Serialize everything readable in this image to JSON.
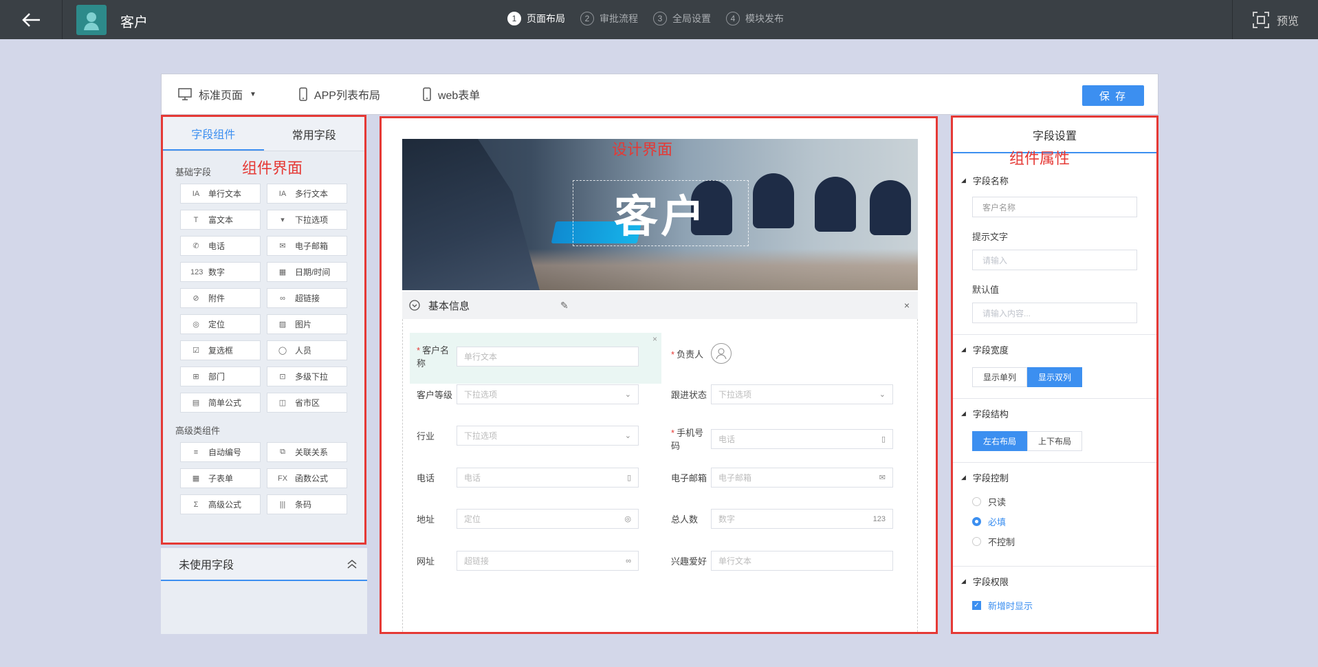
{
  "topbar": {
    "title": "客户",
    "steps": [
      {
        "num": "1",
        "label": "页面布局",
        "active": true
      },
      {
        "num": "2",
        "label": "审批流程",
        "active": false
      },
      {
        "num": "3",
        "label": "全局设置",
        "active": false
      },
      {
        "num": "4",
        "label": "模块发布",
        "active": false
      }
    ],
    "preview": "预览"
  },
  "modes": [
    {
      "label": "标准页面",
      "icon": "desktop-icon"
    },
    {
      "label": "APP列表布局",
      "icon": "mobile-icon"
    },
    {
      "label": "web表单",
      "icon": "mobile-icon"
    }
  ],
  "save_label": "保 存",
  "left": {
    "tabs": [
      "字段组件",
      "常用字段"
    ],
    "annotation": "组件界面",
    "basic_title": "基础字段",
    "basic": [
      {
        "icon": "IA",
        "label": "单行文本"
      },
      {
        "icon": "IA",
        "label": "多行文本"
      },
      {
        "icon": "T",
        "label": "富文本"
      },
      {
        "icon": "▾",
        "label": "下拉选项"
      },
      {
        "icon": "✆",
        "label": "电话"
      },
      {
        "icon": "✉",
        "label": "电子邮箱"
      },
      {
        "icon": "123",
        "label": "数字"
      },
      {
        "icon": "▦",
        "label": "日期/时间"
      },
      {
        "icon": "⊘",
        "label": "附件"
      },
      {
        "icon": "∞",
        "label": "超链接"
      },
      {
        "icon": "◎",
        "label": "定位"
      },
      {
        "icon": "▨",
        "label": "图片"
      },
      {
        "icon": "☑",
        "label": "复选框"
      },
      {
        "icon": "◯",
        "label": "人员"
      },
      {
        "icon": "⊞",
        "label": "部门"
      },
      {
        "icon": "⊡",
        "label": "多级下拉"
      },
      {
        "icon": "▤",
        "label": "简单公式"
      },
      {
        "icon": "◫",
        "label": "省市区"
      }
    ],
    "advanced_title": "高级类组件",
    "advanced": [
      {
        "icon": "≡",
        "label": "自动编号"
      },
      {
        "icon": "⧉",
        "label": "关联关系"
      },
      {
        "icon": "▦",
        "label": "子表单"
      },
      {
        "icon": "FX",
        "label": "函数公式"
      },
      {
        "icon": "Σ",
        "label": "高级公式"
      },
      {
        "icon": "|||",
        "label": "条码"
      }
    ],
    "unused_title": "未使用字段"
  },
  "center": {
    "annotation": "设计界面",
    "banner_title": "客户",
    "section_title": "基本信息",
    "fields": [
      {
        "label": "客户名称",
        "required": true,
        "placeholder": "单行文本",
        "icon": ""
      },
      {
        "label": "负责人",
        "required": true,
        "placeholder": "",
        "icon": "user"
      },
      {
        "label": "客户等级",
        "required": false,
        "placeholder": "下拉选项",
        "icon": "⌄"
      },
      {
        "label": "跟进状态",
        "required": false,
        "placeholder": "下拉选项",
        "icon": "⌄"
      },
      {
        "label": "行业",
        "required": false,
        "placeholder": "下拉选项",
        "icon": "⌄"
      },
      {
        "label": "手机号码",
        "required": true,
        "placeholder": "电话",
        "icon": "▯"
      },
      {
        "label": "电话",
        "required": false,
        "placeholder": "电话",
        "icon": "▯"
      },
      {
        "label": "电子邮箱",
        "required": false,
        "placeholder": "电子邮箱",
        "icon": "✉"
      },
      {
        "label": "地址",
        "required": false,
        "placeholder": "定位",
        "icon": "◎"
      },
      {
        "label": "总人数",
        "required": false,
        "placeholder": "数字",
        "icon": "123"
      },
      {
        "label": "网址",
        "required": false,
        "placeholder": "超链接",
        "icon": "∞"
      },
      {
        "label": "兴趣爱好",
        "required": false,
        "placeholder": "单行文本",
        "icon": ""
      }
    ]
  },
  "right": {
    "title": "字段设置",
    "annotation": "组件属性",
    "name_title": "字段名称",
    "name_value": "客户名称",
    "hint_title": "提示文字",
    "hint_placeholder": "请输入",
    "default_title": "默认值",
    "default_placeholder": "请输入内容...",
    "width_title": "字段宽度",
    "width_opts": [
      "显示单列",
      "显示双列"
    ],
    "struct_title": "字段结构",
    "struct_opts": [
      "左右布局",
      "上下布局"
    ],
    "control_title": "字段控制",
    "control_opts": [
      "只读",
      "必填",
      "不控制"
    ],
    "perm_title": "字段权限",
    "perm_opt": "新增时显示"
  }
}
